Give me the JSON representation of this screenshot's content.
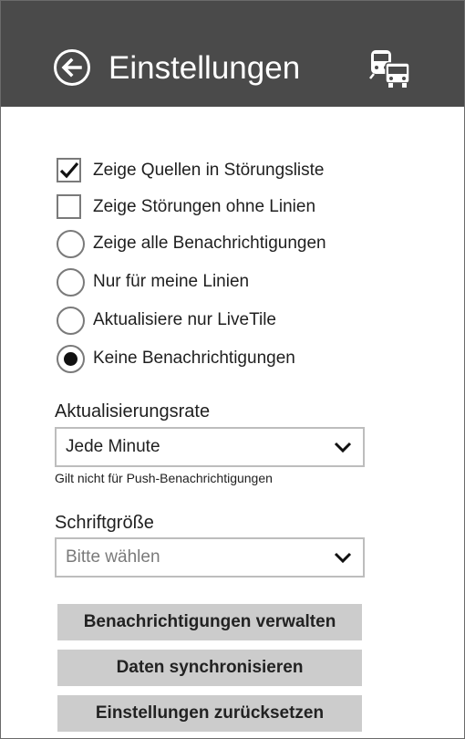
{
  "header": {
    "title": "Einstellungen",
    "back_icon": "back-arrow-icon",
    "app_icon": "train-bus-icon",
    "background": "#4a4a4a"
  },
  "options": {
    "show_sources": {
      "label": "Zeige Quellen in Störungsliste",
      "checked": true
    },
    "show_without_lines": {
      "label": "Zeige Störungen ohne Linien",
      "checked": false
    },
    "notify_all": {
      "label": "Zeige alle Benachrichtigungen",
      "selected": false
    },
    "notify_my_lines": {
      "label": "Nur für meine Linien",
      "selected": false
    },
    "notify_livetile": {
      "label": "Aktualisiere nur LiveTile",
      "selected": false
    },
    "notify_none": {
      "label": "Keine Benachrichtigungen",
      "selected": true
    }
  },
  "refresh_rate": {
    "label": "Aktualisierungsrate",
    "value": "Jede Minute",
    "hint": "Gilt nicht für Push-Benachrichtigungen"
  },
  "font_size": {
    "label": "Schriftgröße",
    "placeholder": "Bitte wählen"
  },
  "buttons": {
    "manage_notifications": "Benachrichtigungen verwalten",
    "sync_data": "Daten synchronisieren",
    "reset_settings": "Einstellungen zurücksetzen"
  }
}
